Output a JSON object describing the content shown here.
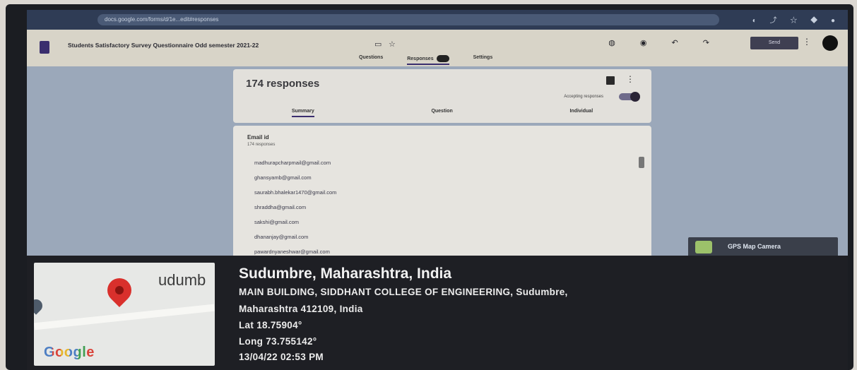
{
  "browser": {
    "url": "docs.google.com/forms/d/1e...edit#responses",
    "icons": [
      "zoom-icon",
      "share-icon",
      "star-icon",
      "extension-icon",
      "profile-icon"
    ]
  },
  "form": {
    "title": "Students Satisfactory Survey Questionnaire Odd semester 2021-22",
    "send_label": "Send",
    "tabs": [
      "Questions",
      "Responses",
      "Settings"
    ]
  },
  "responses": {
    "count_label": "174 responses",
    "accepting_label": "Accepting responses",
    "sub_tabs": [
      "Summary",
      "Question",
      "Individual"
    ],
    "question_title": "Email id",
    "question_count": "174 responses",
    "emails": [
      "madhurapcharpmail@gmail.com",
      "ghansyamb@gmail.com",
      "saurabh.bhalekar1470@gmail.com",
      "shraddha@gmail.com",
      "sakshi@gmail.com",
      "dhananjay@gmail.com",
      "pawardnyaneshwar@gmail.com"
    ]
  },
  "gps": {
    "badge_label": "GPS Map Camera"
  },
  "location": {
    "map_place": "udumb",
    "google_label": "Google",
    "title": "Sudumbre, Maharashtra, India",
    "address_line1": "MAIN BUILDING, SIDDHANT COLLEGE OF ENGINEERING, Sudumbre,",
    "address_line2": "Maharashtra 412109, India",
    "lat": "Lat 18.75904°",
    "long": "Long 73.755142°",
    "timestamp": "13/04/22 02:53 PM"
  },
  "colors": {
    "accent": "#3a2e6e",
    "overlay": "#1e1f24",
    "pin": "#d9302c"
  }
}
